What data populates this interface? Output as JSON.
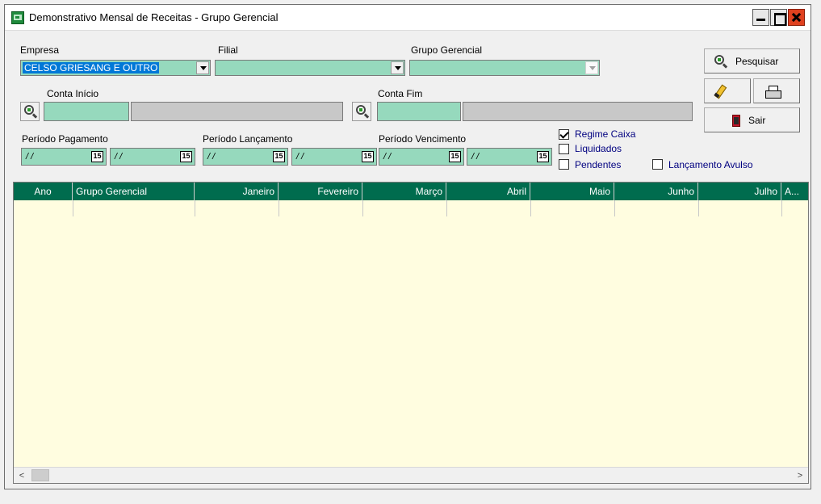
{
  "window": {
    "title": "Demonstrativo Mensal de Receitas - Grupo Gerencial"
  },
  "filters": {
    "empresa_label": "Empresa",
    "empresa_value": "CELSO GRIESANG E OUTRO",
    "filial_label": "Filial",
    "grupo_label": "Grupo Gerencial",
    "conta_inicio_label": "Conta Início",
    "conta_fim_label": "Conta Fim",
    "periodo_pagamento_label": "Período Pagamento",
    "periodo_lancamento_label": "Período Lançamento",
    "periodo_vencimento_label": "Período Vencimento",
    "date_placeholder": "/ /",
    "calendar_day": "15"
  },
  "options": {
    "regime_caixa": "Regime Caixa",
    "liquidados": "Liquidados",
    "pendentes": "Pendentes",
    "lancamento_avulso": "Lançamento Avulso",
    "regime_caixa_checked": true,
    "liquidados_checked": false,
    "pendentes_checked": false,
    "lancamento_avulso_checked": false
  },
  "buttons": {
    "pesquisar": "Pesquisar",
    "sair": "Sair"
  },
  "grid": {
    "columns": [
      "Ano",
      "Grupo Gerencial",
      "Janeiro",
      "Fevereiro",
      "Março",
      "Abril",
      "Maio",
      "Junho",
      "Julho",
      "A..."
    ]
  },
  "scrollbar": {
    "left_arrow": "<",
    "right_arrow": ">"
  },
  "colors": {
    "field_green": "#96d9bd",
    "header_green": "#006c4e",
    "grid_background": "#fffde0",
    "selection_blue": "#0078d7"
  }
}
